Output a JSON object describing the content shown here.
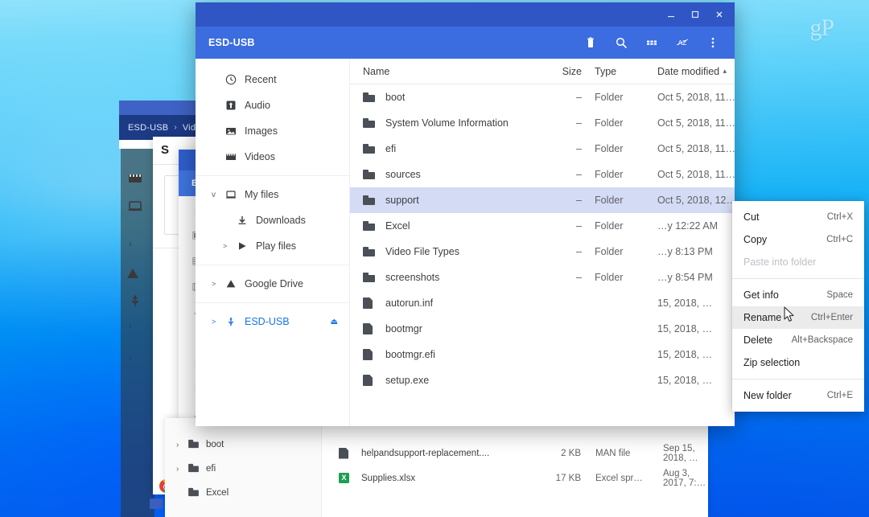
{
  "desktop": {
    "watermark": "gP",
    "wallpaper_top_color": "#8fe2fb",
    "wallpaper_bottom_color": "#0560e6"
  },
  "main_window": {
    "title": "ESD-USB",
    "titlebar_color": "#3b6ce0",
    "window_controls": [
      {
        "name": "minimize-button",
        "glyph": "—"
      },
      {
        "name": "maximize-button",
        "glyph": "▢"
      },
      {
        "name": "close-button",
        "glyph": "✕"
      }
    ],
    "toolbar_buttons": [
      {
        "name": "delete-icon",
        "label": "Delete"
      },
      {
        "name": "search-icon",
        "label": "Search"
      },
      {
        "name": "grid-view-icon",
        "label": "Switch to thumbnail view"
      },
      {
        "name": "sort-az-icon",
        "label": "AZ"
      },
      {
        "name": "more-options-icon",
        "label": "More…"
      }
    ],
    "sidebar": {
      "items": [
        {
          "label": "Recent",
          "icon": "clock-icon",
          "chevron": "",
          "indent": false,
          "active": false
        },
        {
          "label": "Audio",
          "icon": "audio-icon",
          "chevron": "",
          "indent": false,
          "active": false
        },
        {
          "label": "Images",
          "icon": "image-icon",
          "chevron": "",
          "indent": false,
          "active": false
        },
        {
          "label": "Videos",
          "icon": "video-icon",
          "chevron": "",
          "indent": false,
          "active": false
        },
        {
          "label": "My files",
          "icon": "laptop-icon",
          "chevron": "v",
          "indent": false,
          "active": false
        },
        {
          "label": "Downloads",
          "icon": "download-icon",
          "chevron": "",
          "indent": true,
          "active": false
        },
        {
          "label": "Play files",
          "icon": "play-icon",
          "chevron": ">",
          "indent": true,
          "active": false
        },
        {
          "label": "Google Drive",
          "icon": "drive-icon",
          "chevron": ">",
          "indent": false,
          "active": false
        },
        {
          "label": "ESD-USB",
          "icon": "usb-icon",
          "chevron": ">",
          "indent": false,
          "active": true,
          "eject": "⏏"
        }
      ]
    },
    "file_list": {
      "columns": {
        "name": "Name",
        "size": "Size",
        "type": "Type",
        "date": "Date modified",
        "sort_indicator": "▴"
      },
      "rows": [
        {
          "name": "boot",
          "size": "–",
          "type": "Folder",
          "date": "Oct 5, 2018, 11…",
          "icon": "folder-icon",
          "selected": false
        },
        {
          "name": "System Volume Information",
          "size": "–",
          "type": "Folder",
          "date": "Oct 5, 2018, 11…",
          "icon": "folder-icon",
          "selected": false
        },
        {
          "name": "efi",
          "size": "–",
          "type": "Folder",
          "date": "Oct 5, 2018, 11…",
          "icon": "folder-icon",
          "selected": false
        },
        {
          "name": "sources",
          "size": "–",
          "type": "Folder",
          "date": "Oct 5, 2018, 11…",
          "icon": "folder-icon",
          "selected": false
        },
        {
          "name": "support",
          "size": "–",
          "type": "Folder",
          "date": "Oct 5, 2018, 12…",
          "icon": "folder-icon",
          "selected": true
        },
        {
          "name": "Excel",
          "size": "–",
          "type": "Folder",
          "date": "…y 12:22 AM",
          "icon": "folder-icon",
          "selected": false
        },
        {
          "name": "Video File Types",
          "size": "–",
          "type": "Folder",
          "date": "…y 8:13 PM",
          "icon": "folder-icon",
          "selected": false
        },
        {
          "name": "screenshots",
          "size": "–",
          "type": "Folder",
          "date": "…y 8:54 PM",
          "icon": "folder-icon",
          "selected": false
        },
        {
          "name": "autorun.inf",
          "size": "",
          "type": "",
          "date": "15, 2018, …",
          "icon": "file-icon",
          "selected": false
        },
        {
          "name": "bootmgr",
          "size": "",
          "type": "",
          "date": "15, 2018, …",
          "icon": "file-icon",
          "selected": false
        },
        {
          "name": "bootmgr.efi",
          "size": "",
          "type": "",
          "date": "15, 2018, …",
          "icon": "file-icon",
          "selected": false
        },
        {
          "name": "setup.exe",
          "size": "",
          "type": "",
          "date": "15, 2018, …",
          "icon": "file-icon",
          "selected": false
        }
      ]
    }
  },
  "context_menu": {
    "items": [
      {
        "label": "Cut",
        "accel": "Ctrl+X",
        "disabled": false,
        "hover": false,
        "separator_after": false
      },
      {
        "label": "Copy",
        "accel": "Ctrl+C",
        "disabled": false,
        "hover": false,
        "separator_after": false
      },
      {
        "label": "Paste into folder",
        "accel": "",
        "disabled": true,
        "hover": false,
        "separator_after": true
      },
      {
        "label": "Get info",
        "accel": "Space",
        "disabled": false,
        "hover": false,
        "separator_after": false
      },
      {
        "label": "Rename",
        "accel": "Ctrl+Enter",
        "disabled": false,
        "hover": true,
        "separator_after": false
      },
      {
        "label": "Delete",
        "accel": "Alt+Backspace",
        "disabled": false,
        "hover": false,
        "separator_after": false
      },
      {
        "label": "Zip selection",
        "accel": "",
        "disabled": false,
        "hover": false,
        "separator_after": true
      },
      {
        "label": "New folder",
        "accel": "Ctrl+E",
        "disabled": false,
        "hover": false,
        "separator_after": false
      }
    ]
  },
  "background_window_a": {
    "breadcrumb_root": "ESD-USB",
    "breadcrumb_sep": "›",
    "breadcrumb_child": "Vid"
  },
  "background_window_b": {
    "title": "S"
  },
  "background_window_c": {
    "title": "ESD",
    "items": [
      {
        "icon": "clock-icon",
        "chevron": ""
      },
      {
        "icon": "audio-icon",
        "chevron": ""
      },
      {
        "icon": "image-icon",
        "chevron": ""
      },
      {
        "icon": "video-icon",
        "chevron": ""
      },
      {
        "icon": "laptop-icon",
        "chevron": "v"
      },
      {
        "icon": "download-icon",
        "chevron": ""
      },
      {
        "icon": "play-icon",
        "chevron": ">"
      },
      {
        "icon": "drive-icon",
        "chevron": ">"
      },
      {
        "icon": "usb-icon",
        "chevron": "v"
      },
      {
        "icon": "folder-icon",
        "chevron": ">"
      },
      {
        "icon": "folder-icon",
        "chevron": ">"
      }
    ]
  },
  "background_window_d": {
    "sidebar_rows": [
      {
        "label": "boot",
        "chevron": "›"
      },
      {
        "label": "efi",
        "chevron": "›"
      },
      {
        "label": "Excel",
        "chevron": ""
      }
    ],
    "rows": [
      {
        "name": "helpandsupport-replacement....",
        "size": "2 KB",
        "type": "MAN file",
        "date": "Sep 15, 2018, …",
        "icon": "file-icon"
      },
      {
        "name": "Supplies.xlsx",
        "size": "17 KB",
        "type": "Excel spr…",
        "date": "Aug 3, 2017, 7:…",
        "icon": "xls-icon",
        "badge": "X"
      }
    ]
  }
}
